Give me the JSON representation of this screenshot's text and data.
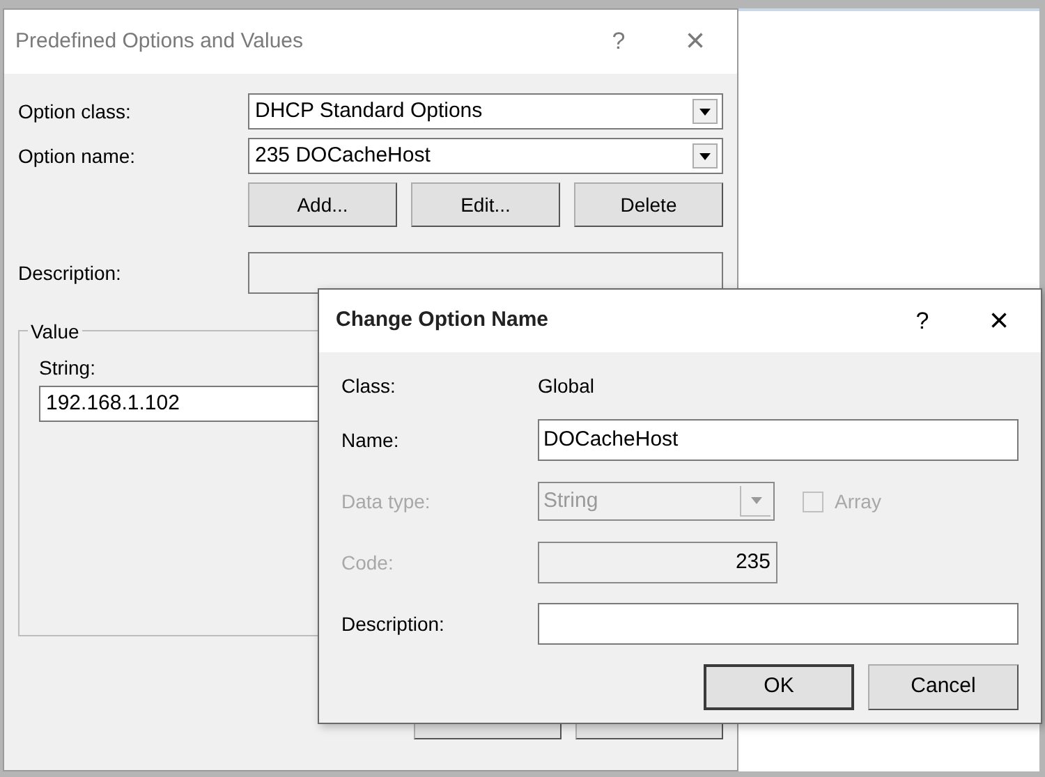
{
  "main_dialog": {
    "title": "Predefined Options and Values",
    "help": "?",
    "close": "×",
    "option_class": {
      "label": "Option class:",
      "value": "DHCP Standard Options"
    },
    "option_name": {
      "label": "Option name:",
      "value": "235 DOCacheHost"
    },
    "buttons": [
      "Add...",
      "Edit...",
      "Delete"
    ],
    "description": {
      "label": "Description:"
    },
    "value_group": {
      "title": "Value",
      "string_label": "String:",
      "string_value": "192.168.1.102"
    }
  },
  "change_dialog": {
    "title": "Change Option Name",
    "help": "?",
    "close": "×",
    "rows": [
      {
        "kind": "text",
        "label": "Class:",
        "value": "Global",
        "disabled": false
      },
      {
        "kind": "input",
        "label": "Name:",
        "value": "DOCacheHost",
        "disabled": false
      },
      {
        "kind": "select",
        "label": "Data type:",
        "value": "String",
        "disabled": true,
        "checkbox": {
          "label": "Array",
          "checked": false
        }
      },
      {
        "kind": "code",
        "label": "Code:",
        "value": "235",
        "disabled": true
      },
      {
        "kind": "input",
        "label": "Description:",
        "value": "",
        "disabled": false
      }
    ],
    "buttons": [
      "OK",
      "Cancel"
    ]
  }
}
